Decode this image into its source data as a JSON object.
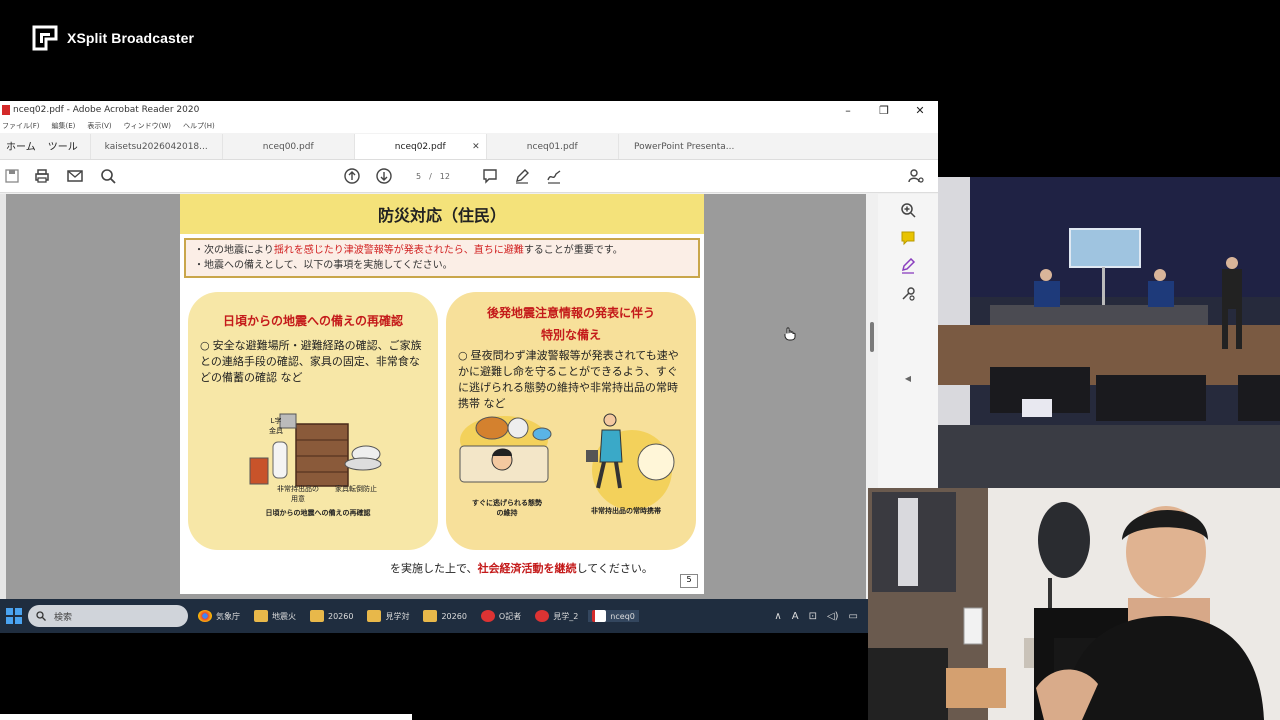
{
  "app": {
    "name": "XSplit Broadcaster"
  },
  "acrobat": {
    "title": "nceq02.pdf - Adobe Acrobat Reader 2020",
    "menu": [
      "ファイル(F)",
      "編集(E)",
      "表示(V)",
      "ウィンドウ(W)",
      "ヘルプ(H)"
    ],
    "home_tabs": [
      "ホーム",
      "ツール"
    ],
    "tabs": [
      {
        "label": "kaisetsu2026042018..."
      },
      {
        "label": "nceq00.pdf"
      },
      {
        "label": "nceq02.pdf",
        "active": true
      },
      {
        "label": "nceq01.pdf"
      },
      {
        "label": "PowerPoint Presenta..."
      }
    ],
    "page_current": "5",
    "page_sep": "/",
    "page_total": "12"
  },
  "slide": {
    "title": "防災対応（住民）",
    "note_line1_a": "・次の地震により",
    "note_line1_red1": "揺れを感じたり津波警報等が発表されたら、直ちに避難",
    "note_line1_b": "することが重要です。",
    "note_line2": "・地震への備えとして、以下の事項を実施してください。",
    "left_head": "日頃からの地震への備えの再確認",
    "left_body": "安全な避難場所・避難経路の確認、ご家族との連絡手段の確認、家具の固定、非常食などの備蓄の確認 など",
    "left_caption": "日頃からの地震への備えの再確認",
    "left_small_1": "L字金具",
    "left_small_2": "非常持出品の用意",
    "left_small_3": "家具転倒防止",
    "right_head_1": "後発地震注意情報の発表に伴う",
    "right_head_2": "特別な備え",
    "right_body": "昼夜問わず津波警報等が発表されても速やかに避難し命を守ることができるよう、すぐに逃げられる態勢の維持や非常持出品の常時携帯 など",
    "right_caption_1": "すぐに逃げられる態勢の維持",
    "right_caption_2": "非常持出品の常時携帯",
    "bottom_a": "を実施した上で、",
    "bottom_red": "社会経済活動を継続",
    "bottom_b": "してください。",
    "page_no": "5"
  },
  "taskbar": {
    "search_placeholder": "検索",
    "items": [
      "気象庁",
      "地震火",
      "20260",
      "見学対",
      "20260",
      "O記者",
      "見学_2",
      "nceq0"
    ]
  },
  "colors": {
    "title_band": "#f4e27a",
    "accent_red": "#c41a1a",
    "taskbar": "#1f2d3f"
  }
}
